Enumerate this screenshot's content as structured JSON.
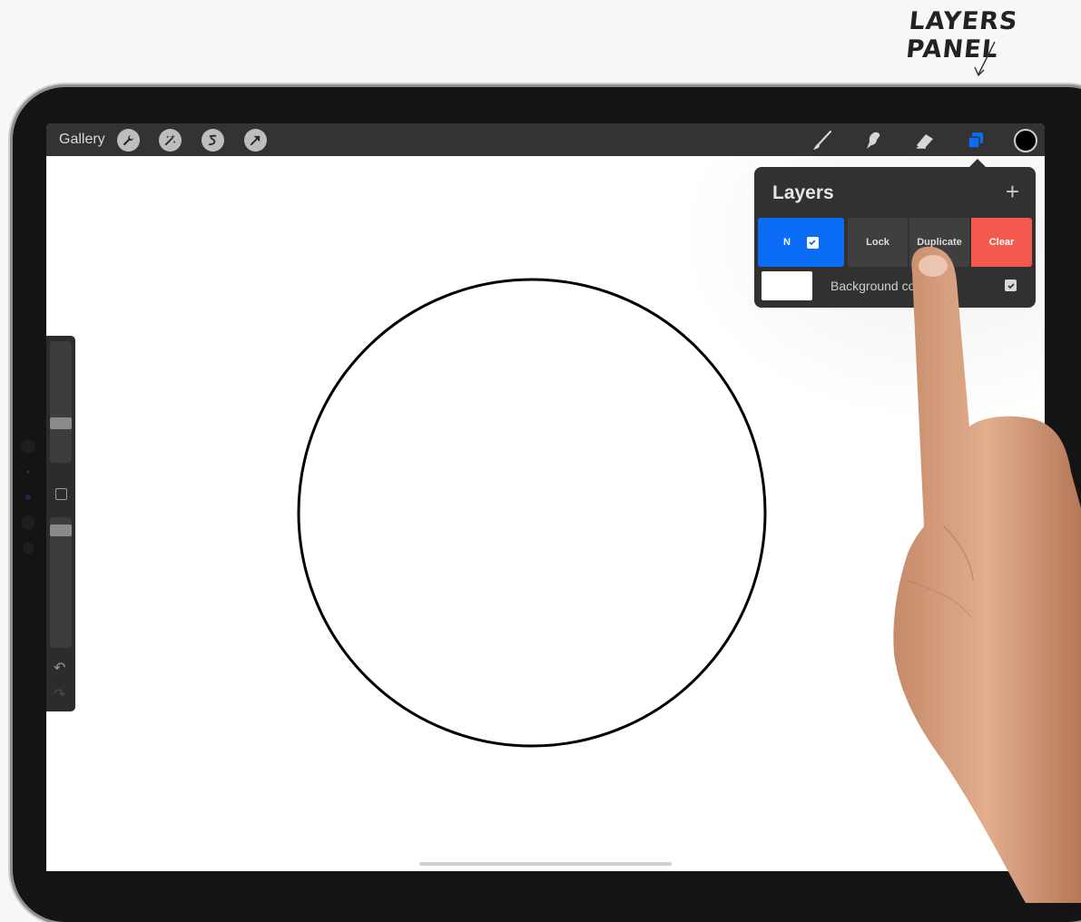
{
  "annotation": {
    "label": "LAYERS PANEL"
  },
  "toolbar": {
    "gallery_label": "Gallery",
    "left_tools": [
      "wrench-icon",
      "magic-wand-icon",
      "selection-icon",
      "transform-arrow-icon"
    ],
    "right_tools": [
      "brush-icon",
      "smudge-icon",
      "eraser-icon",
      "layers-icon"
    ],
    "active_tool": "layers-icon",
    "active_color": "#000000",
    "accent_color": "#0b6cf5"
  },
  "layers_panel": {
    "title": "Layers",
    "add_label": "+",
    "selected_layer": {
      "blend_mode": "N",
      "visible": true,
      "actions": {
        "lock": "Lock",
        "duplicate": "Duplicate",
        "clear": "Clear"
      }
    },
    "background_layer": {
      "label": "Background co",
      "visible": true,
      "color": "#ffffff"
    }
  },
  "sidebar": {
    "undo": "↶",
    "redo": "↷"
  }
}
